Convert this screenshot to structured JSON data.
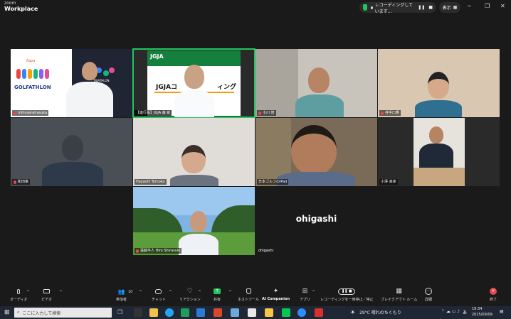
{
  "app": {
    "brand_top": "zoom",
    "brand_bottom": "Workplace"
  },
  "titlebar": {
    "recording_text": "レコーディングしています...",
    "view_label": "表示"
  },
  "tiles": [
    {
      "name": "mihosarahasuka"
    },
    {
      "name": "【進行役】JGJA 森 彰"
    },
    {
      "name": "小川 修"
    },
    {
      "name": "井手口香"
    },
    {
      "name": "和田章"
    },
    {
      "name": "Hayashi Tomoko"
    },
    {
      "name": "日本ゴルフのiPad"
    },
    {
      "name": "小澤 高幸"
    },
    {
      "name": "遠越平人 Hiro Shirasuki"
    },
    {
      "name": "ohigashi"
    }
  ],
  "slide": {
    "logo": "JGJA",
    "title": "JGJAコ",
    "title_tail": "ィング"
  },
  "golf_logo": {
    "small": "Kapa",
    "main": "GOLFATHLON",
    "side": "TRIATHLON"
  },
  "ohigashi_label": "ohigashi",
  "toolbar": {
    "audio": "オーディオ",
    "video": "ビデオ",
    "participants": "参加者",
    "participants_count": "10",
    "chat": "チャット",
    "reactions": "リアクション",
    "share": "共有",
    "host_tools": "ホストツール",
    "ai_companion": "AI Companion",
    "apps": "アプリ",
    "recording": "レコーディングを一時停止／停止",
    "breakout": "ブレイクアウト ルーム",
    "more": "詳細",
    "end": "終了"
  },
  "taskbar": {
    "search_placeholder": "ここに入力して検索",
    "weather": "29°C 晴れのちくもり",
    "ime": "あ",
    "time": "19:34",
    "date": "2025/09/09"
  },
  "colors": {
    "active_border": "#22c55e",
    "end_red": "#e5484d",
    "share_green": "#22c55e"
  }
}
